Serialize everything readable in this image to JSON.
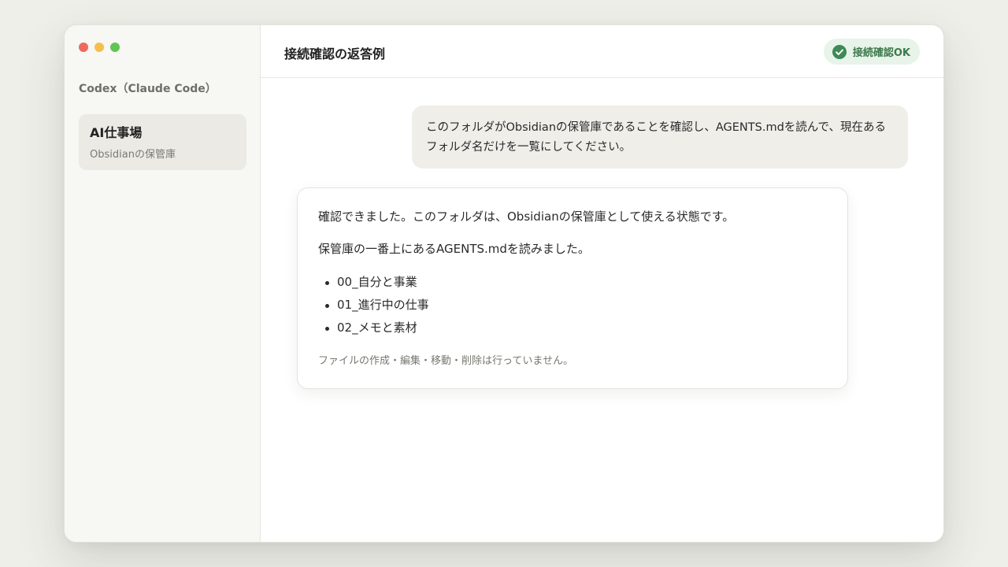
{
  "sidebar": {
    "app_title": "Codex（Claude Code）",
    "project": {
      "name": "AI仕事場",
      "subtitle": "Obsidianの保管庫"
    }
  },
  "header": {
    "title": "接続確認の返答例",
    "status": {
      "label": "接続確認OK",
      "icon": "check-circle-icon",
      "color": "#3d7a4c"
    }
  },
  "conversation": {
    "user_message": "このフォルダがObsidianの保管庫であることを確認し、AGENTS.mdを読んで、現在あるフォルダ名だけを一覧にしてください。",
    "assistant": {
      "line1": "確認できました。このフォルダは、Obsidianの保管庫として使える状態です。",
      "line2": "保管庫の一番上にあるAGENTS.mdを読みました。",
      "folders": [
        "00_自分と事業",
        "01_進行中の仕事",
        "02_メモと素材"
      ],
      "note": "ファイルの作成・編集・移動・削除は行っていません。"
    }
  },
  "colors": {
    "close": "#ed6a5e",
    "minimize": "#f4bf4f",
    "zoom": "#61c554"
  }
}
